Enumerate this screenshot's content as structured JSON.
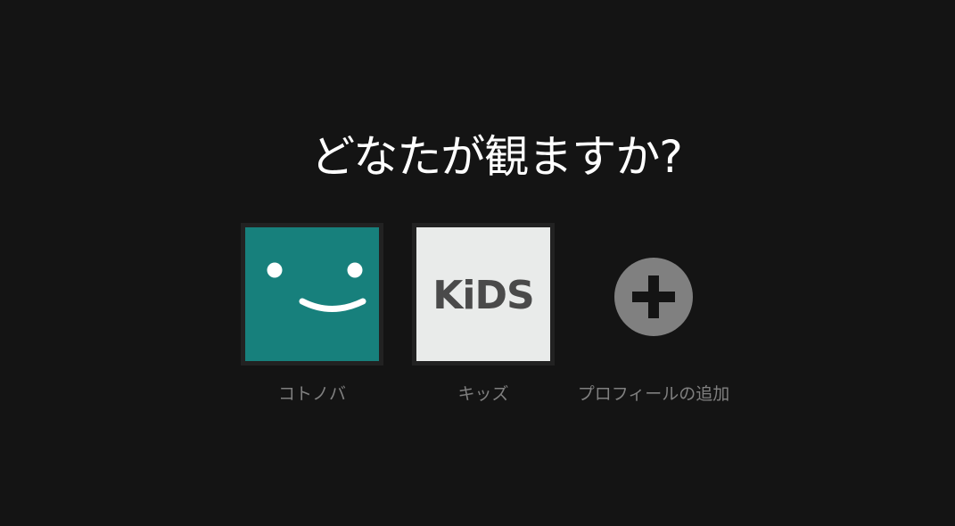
{
  "title": "どなたが観ますか?",
  "profiles": [
    {
      "name": "コトノバ",
      "avatar": "smiley-icon",
      "color": "#17807c"
    },
    {
      "name": "キッズ",
      "avatar": "kids-logo",
      "logo_text": "KiDS",
      "color": "#e9ebea"
    },
    {
      "name": "プロフィールの追加",
      "avatar": "add-profile-icon",
      "color": "#808080"
    }
  ]
}
